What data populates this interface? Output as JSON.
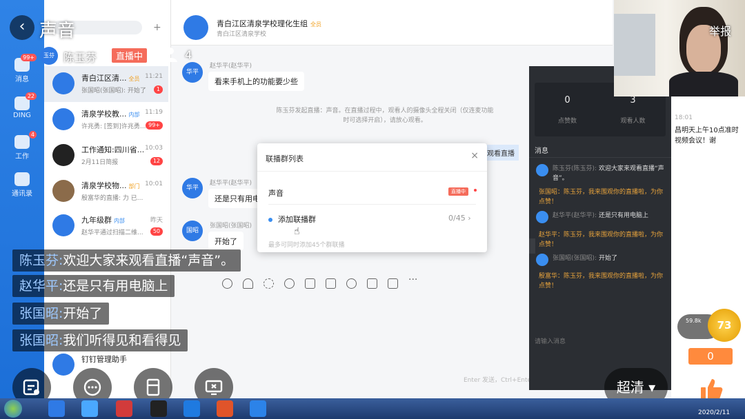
{
  "live": {
    "title": "声音",
    "host_avatar": "玉芬",
    "host_name": "陈玉芬",
    "live_badge": "直播中",
    "viewer_count": "4",
    "report": "举报",
    "hd_label": "超清",
    "like_count": "0",
    "gift_text": "59.8k",
    "gift_level": "73"
  },
  "comments": [
    {
      "name": "陈玉芬:",
      "text": "欢迎大家来观看直播“声音”。"
    },
    {
      "name": "赵华平:",
      "text": "还是只有用电脑上"
    },
    {
      "name": "张国昭:",
      "text": "开始了"
    },
    {
      "name": "张国昭:",
      "text": "我们听得见和看得见"
    }
  ],
  "sidebar": {
    "items": [
      {
        "label": "消息",
        "badge": "99+"
      },
      {
        "label": "DING",
        "badge": "22"
      },
      {
        "label": "工作",
        "badge": "4"
      },
      {
        "label": "通讯录",
        "badge": ""
      }
    ]
  },
  "conversations": [
    {
      "title": "青白江区清...",
      "tag": "全员",
      "time": "11:21",
      "preview": "张国昭(张国昭): 开始了",
      "badge": "1"
    },
    {
      "title": "清泉学校教...",
      "tag": "内部",
      "time": "11:19",
      "preview": "许兆勇: [签到]许兆勇...",
      "badge": "99+"
    },
    {
      "title": "工作通知:四川省...",
      "tag": "",
      "time": "10:03",
      "preview": "2月11日简报",
      "badge": "12"
    },
    {
      "title": "清泉学校物...",
      "tag": "部门",
      "time": "10:01",
      "preview": "殷富华的直播: 力 已...",
      "badge": ""
    },
    {
      "title": "九年级群",
      "tag": "内部",
      "time": "昨天",
      "preview": "赵华平通过扫描二维...",
      "badge": "50"
    },
    {
      "title": "钉钉管理助手",
      "tag": "",
      "time": "",
      "preview": "",
      "badge": ""
    }
  ],
  "chat": {
    "group_title": "青白江区清泉学校理化生组",
    "group_tag": "全员",
    "group_subtitle": "青白江区清泉学校",
    "messages": [
      {
        "avatar": "华平",
        "name": "赵华平(赵华平)",
        "text": "看来手机上的功能要少些"
      },
      {
        "avatar": "华平",
        "name": "赵华平(赵华平)",
        "text": "还是只有用电"
      },
      {
        "avatar": "国昭",
        "name": "张国昭(张国昭)",
        "text": "开始了"
      }
    ],
    "system_note": "陈玉芬发起直播：声音。在直播过程中，观看人的摄像头全程关闭（仅连麦功能时可选择开启），请放心观看。",
    "strip_text": "观看直播",
    "enter_hint": "Enter 发送，Ctrl+Enter"
  },
  "dialog": {
    "title": "联播群列表",
    "row1": "声音",
    "row1_badge": "直播中",
    "add_label": "添加联播群",
    "count": "0/45",
    "hint": "最多可同时添加45个群联播"
  },
  "panel": {
    "likes": "0",
    "likes_label": "点赞数",
    "viewers": "3",
    "viewers_label": "观看人数",
    "msg_title": "消息",
    "input_placeholder": "请输入消息",
    "items": [
      {
        "name": "陈玉芬(陈玉芬):",
        "text": "欢迎大家来观看直播“声音”。"
      },
      {
        "warn": "张国昭：陈玉芬，我来围观你的直播啦，为你点赞！"
      },
      {
        "name": "赵华平(赵华平):",
        "text": "还是只有用电脑上"
      },
      {
        "warn": "赵华平：陈玉芬，我来围观你的直播啦，为你点赞！"
      },
      {
        "name": "张国昭(张国昭):",
        "text": "开始了"
      },
      {
        "warn": "殷富华：陈玉芬，我来围观你的直播啦，为你点赞！"
      }
    ]
  },
  "right_strip": {
    "time": "18:01",
    "text": "昌明天上午10点准时视频会议！谢"
  },
  "taskbar": {
    "date": "2020/2/11"
  },
  "colors": {
    "rail_blue": "#2f83e6",
    "live_red": "#f56c5b",
    "warn_orange": "#e6a23c",
    "like_orange": "#ff8a3d"
  }
}
